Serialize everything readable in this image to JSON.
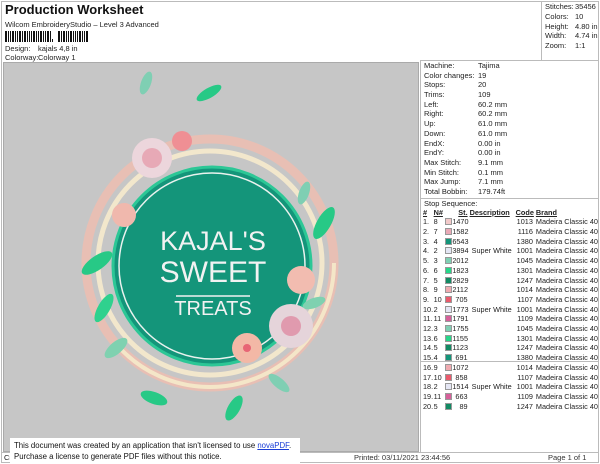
{
  "header": {
    "title": "Production Worksheet",
    "subtitle": "Wilcom EmbroideryStudio – Level 3 Advanced",
    "design_label": "Design:",
    "design_value": "kajals 4,8 in",
    "colorway_label": "Colorway:",
    "colorway_value": "Colorway 1"
  },
  "stats": [
    {
      "k": "Stitches:",
      "v": "35456"
    },
    {
      "k": "Colors:",
      "v": "10"
    },
    {
      "k": "Height:",
      "v": "4.80 in"
    },
    {
      "k": "Width:",
      "v": "4.74 in"
    },
    {
      "k": "Zoom:",
      "v": "1:1"
    }
  ],
  "properties": [
    {
      "k": "Machine:",
      "v": "Tajima"
    },
    {
      "k": "Color changes:",
      "v": "19"
    },
    {
      "k": "Stops:",
      "v": "20"
    },
    {
      "k": "Trims:",
      "v": "109"
    },
    {
      "k": "Left:",
      "v": "60.2 mm"
    },
    {
      "k": "Right:",
      "v": "60.2 mm"
    },
    {
      "k": "Up:",
      "v": "61.0 mm"
    },
    {
      "k": "Down:",
      "v": "61.0 mm"
    },
    {
      "k": "EndX:",
      "v": "0.00 in"
    },
    {
      "k": "EndY:",
      "v": "0.00 in"
    },
    {
      "k": "Max Stitch:",
      "v": "9.1 mm"
    },
    {
      "k": "Min Stitch:",
      "v": "0.1 mm"
    },
    {
      "k": "Max Jump:",
      "v": "7.1 mm"
    },
    {
      "k": "Total Bobbin:",
      "v": "179.74ft"
    }
  ],
  "stop_sequence": {
    "title": "Stop Sequence:",
    "columns": [
      "#",
      "N#",
      "St.",
      "Description",
      "Code",
      "Brand"
    ],
    "rows": [
      [
        "1.",
        "8",
        "#f2c9c9",
        "1470",
        "",
        "1013",
        "Madeira Classic 40"
      ],
      [
        "2.",
        "7",
        "#e9a9b6",
        "1582",
        "",
        "1116",
        "Madeira Classic 40"
      ],
      [
        "3.",
        "4",
        "#14957a",
        "6543",
        "",
        "1380",
        "Madeira Classic 40"
      ],
      [
        "4.",
        "2",
        "#e4e6f4",
        "3894",
        "Super White",
        "1001",
        "Madeira Classic 40"
      ],
      [
        "5.",
        "3",
        "#7fcfb3",
        "2012",
        "",
        "1045",
        "Madeira Classic 40"
      ],
      [
        "6.",
        "6",
        "#27d689",
        "1823",
        "",
        "1301",
        "Madeira Classic 40"
      ],
      [
        "7.",
        "5",
        "#128a63",
        "2829",
        "",
        "1247",
        "Madeira Classic 40"
      ],
      [
        "8.",
        "9",
        "#f0aab0",
        "2112",
        "",
        "1014",
        "Madeira Classic 40"
      ],
      [
        "9.",
        "10",
        "#ea5a6c",
        "705",
        "",
        "1107",
        "Madeira Classic 40"
      ],
      [
        "10.",
        "2",
        "#e4e6f4",
        "1773",
        "Super White",
        "1001",
        "Madeira Classic 40"
      ],
      [
        "11.",
        "11",
        "#d6609a",
        "1791",
        "",
        "1109",
        "Madeira Classic 40"
      ],
      [
        "12.",
        "3",
        "#7fcfb3",
        "1755",
        "",
        "1045",
        "Madeira Classic 40"
      ],
      [
        "13.",
        "6",
        "#27d689",
        "1155",
        "",
        "1301",
        "Madeira Classic 40"
      ],
      [
        "14.",
        "5",
        "#128a63",
        "1123",
        "",
        "1247",
        "Madeira Classic 40"
      ],
      [
        "15.",
        "4",
        "#14957a",
        "691",
        "",
        "1380",
        "Madeira Classic 40"
      ],
      [
        "16.",
        "9",
        "#f0aab0",
        "1072",
        "",
        "1014",
        "Madeira Classic 40"
      ],
      [
        "17.",
        "10",
        "#ea5a6c",
        "858",
        "",
        "1107",
        "Madeira Classic 40"
      ],
      [
        "18.",
        "2",
        "#e4e6f4",
        "1514",
        "Super White",
        "1001",
        "Madeira Classic 40"
      ],
      [
        "19.",
        "11",
        "#d6609a",
        "663",
        "",
        "1109",
        "Madeira Classic 40"
      ],
      [
        "20.",
        "5",
        "#128a63",
        "89",
        "",
        "1247",
        "Madeira Classic 40"
      ]
    ]
  },
  "design_preview": {
    "line1": "KAJAL'S",
    "line2": "SWEET",
    "line3": "TREATS"
  },
  "footer": {
    "left": "Cr",
    "printed": "Printed: 03/11/2021 23:44:56",
    "page": "Page 1 of 1"
  },
  "notice": {
    "line1": "This document was created by an application that isn't licensed to use ",
    "link": "novaPDF",
    "line1_end": ".",
    "line2": "Purchase a license to generate PDF files without this notice."
  }
}
